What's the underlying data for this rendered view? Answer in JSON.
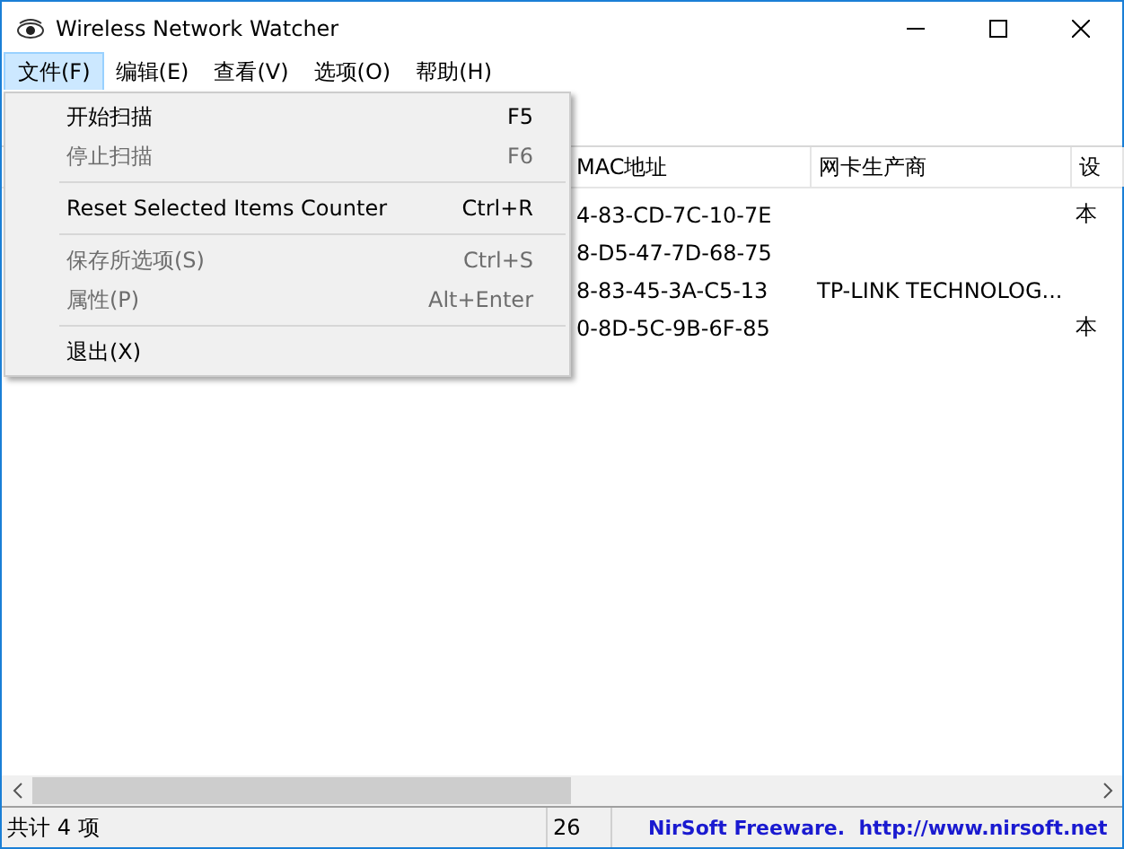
{
  "window": {
    "title": "Wireless Network Watcher"
  },
  "menu_bar": [
    {
      "label": "文件(F)",
      "selected": true
    },
    {
      "label": "编辑(E)",
      "selected": false
    },
    {
      "label": "查看(V)",
      "selected": false
    },
    {
      "label": "选项(O)",
      "selected": false
    },
    {
      "label": "帮助(H)",
      "selected": false
    }
  ],
  "file_menu": [
    {
      "kind": "item",
      "label": "开始扫描",
      "shortcut": "F5",
      "disabled": false
    },
    {
      "kind": "item",
      "label": "停止扫描",
      "shortcut": "F6",
      "disabled": true
    },
    {
      "kind": "separator"
    },
    {
      "kind": "item",
      "label": "Reset Selected Items Counter",
      "shortcut": "Ctrl+R",
      "disabled": false
    },
    {
      "kind": "separator"
    },
    {
      "kind": "item",
      "label": "保存所选项(S)",
      "shortcut": "Ctrl+S",
      "disabled": true
    },
    {
      "kind": "item",
      "label": "属性(P)",
      "shortcut": "Alt+Enter",
      "disabled": true
    },
    {
      "kind": "separator"
    },
    {
      "kind": "item",
      "label": "退出(X)",
      "disabled": false
    }
  ],
  "table": {
    "columns": [
      "MAC地址",
      "网卡生产商",
      "设"
    ],
    "rows": [
      [
        "4-83-CD-7C-10-7E",
        "",
        "本"
      ],
      [
        "8-D5-47-7D-68-75",
        "",
        ""
      ],
      [
        "8-83-45-3A-C5-13",
        "TP-LINK TECHNOLOG...",
        ""
      ],
      [
        "0-8D-5C-9B-6F-85",
        "",
        "本"
      ]
    ]
  },
  "status_bar": {
    "count": "共计 4 项",
    "number": "26",
    "credit": "NirSoft Freeware.  http://www.nirsoft.net"
  }
}
